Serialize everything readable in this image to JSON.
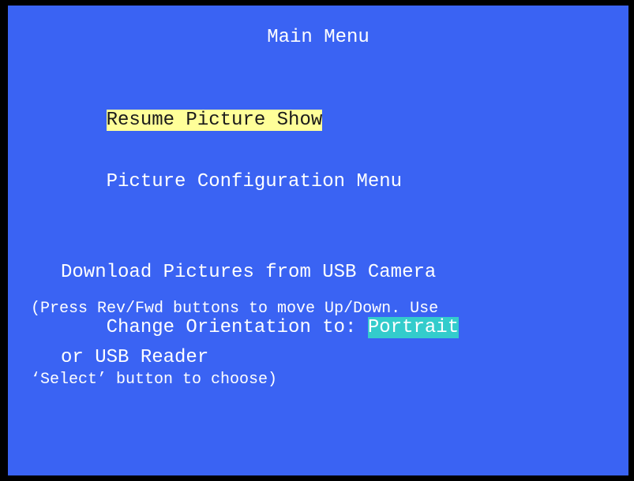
{
  "menu": {
    "title": "Main Menu",
    "items": [
      {
        "label": "Resume Picture Show",
        "selected": true
      },
      {
        "label": "Picture Configuration Menu",
        "selected": false
      },
      {
        "label_line1": "Download Pictures from USB Camera",
        "label_line2": "or USB Reader",
        "selected": false
      },
      {
        "label": "Change Orientation to: ",
        "value": "Portrait",
        "selected": false
      }
    ],
    "instructions_line1": "(Press Rev/Fwd buttons to move Up/Down. Use",
    "instructions_line2": "‘Select’ button to choose)"
  },
  "colors": {
    "background": "#3a63f3",
    "border": "#000000",
    "selected_highlight": "#ffff99",
    "value_highlight": "#33cccc",
    "text": "#ffffff"
  }
}
